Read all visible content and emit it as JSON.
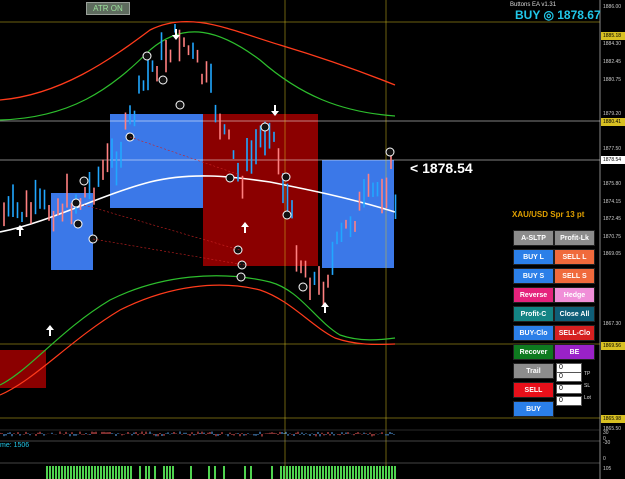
{
  "header": {
    "atr_label": "ATR ON",
    "ea_title": "Buttons EA v1.31",
    "buy_label": "BUY ◎ 1878.67"
  },
  "current_price": "<  1878.54",
  "spread_label": "XAU/USD Spr 13 pt",
  "buttons": [
    {
      "label": "A-SLTP",
      "color": "#8c8c8c"
    },
    {
      "label": "Profit-Lk",
      "color": "#8c8c8c"
    },
    {
      "label": "BUY L",
      "color": "#2b7fe8"
    },
    {
      "label": "SELL L",
      "color": "#f06a3c"
    },
    {
      "label": "BUY S",
      "color": "#2b7fe8"
    },
    {
      "label": "SELL S",
      "color": "#f06a3c"
    },
    {
      "label": "Reverse",
      "color": "#e5227c"
    },
    {
      "label": "Hedge",
      "color": "#f08ed8"
    },
    {
      "label": "Profit-C",
      "color": "#138484"
    },
    {
      "label": "Close All",
      "color": "#0f5e78"
    },
    {
      "label": "BUY-Clo",
      "color": "#2b7fe8"
    },
    {
      "label": "SELL-Clo",
      "color": "#d62020"
    },
    {
      "label": "Recover",
      "color": "#0e7a1f"
    },
    {
      "label": "BE",
      "color": "#9a22c8"
    },
    {
      "label": "Trail",
      "color": "#8c8c8c"
    },
    {
      "label": "SELL",
      "color": "#e8101a"
    },
    {
      "label": "BUY",
      "color": "#2b7fe8"
    }
  ],
  "fields": [
    {
      "value": "0",
      "label": ""
    },
    {
      "value": "0",
      "label": "TP"
    },
    {
      "value": "0",
      "label": "SL"
    },
    {
      "value": "0",
      "label": "Lot"
    }
  ],
  "price_axis": [
    "1886.00",
    "1884.30",
    "1882.45",
    "1880.75",
    "1879.20",
    "1877.50",
    "1875.80",
    "1874.15",
    "1872.45",
    "1870.75",
    "1869.05",
    "1867.30",
    "1865.50"
  ],
  "axis_tags": {
    "top": "1885.18",
    "mid": "1880.41",
    "cur": "1878.54",
    "low": "1869.56",
    "bottom": "1865.98"
  },
  "indicator_axis": [
    "30",
    "0",
    "-30",
    "0",
    "105"
  ],
  "bottom_label": "me: 1506",
  "colors": {
    "bull": "#21a7ff",
    "bear": "#ff8080",
    "range_blue": "#3b78e8",
    "range_red": "#8b0000",
    "ma_red": "#ff3b1b",
    "ma_green": "#2dbe2d",
    "ma_white": "#ffffff",
    "vline": "#d8c022"
  }
}
